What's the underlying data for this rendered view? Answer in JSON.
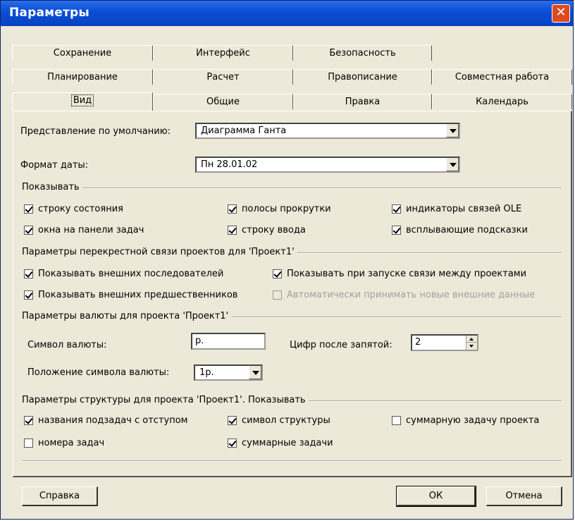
{
  "window": {
    "title": "Параметры",
    "close_glyph": "✕"
  },
  "tabs": {
    "row1": [
      "Сохранение",
      "Интерфейс",
      "Безопасность"
    ],
    "row2": [
      "Планирование",
      "Расчет",
      "Правописание",
      "Совместная работа"
    ],
    "row3": [
      "Вид",
      "Общие",
      "Правка",
      "Календарь"
    ],
    "active": "Вид"
  },
  "view": {
    "default_view_label": "Представление по умолчанию:",
    "default_view_value": "Диаграмма Ганта",
    "date_format_label": "Формат даты:",
    "date_format_value": "Пн 28.01.02"
  },
  "show": {
    "title": "Показывать",
    "items": [
      {
        "label": "строку состояния",
        "checked": true
      },
      {
        "label": "полосы прокрутки",
        "checked": true
      },
      {
        "label": "индикаторы связей OLE",
        "checked": true
      },
      {
        "label": "окна на панели задач",
        "checked": true
      },
      {
        "label": "строку ввода",
        "checked": true
      },
      {
        "label": "всплывающие подсказки",
        "checked": true
      }
    ]
  },
  "crosslink": {
    "title": "Параметры перекрестной связи проектов для 'Проект1'",
    "items": [
      {
        "label": "Показывать внешних последователей",
        "checked": true
      },
      {
        "label": "Показывать при запуске связи между проектами",
        "checked": true
      },
      {
        "label": "Показывать внешних предшественников",
        "checked": true
      },
      {
        "label": "Автоматически принимать новые внешние данные",
        "checked": false,
        "disabled": true
      }
    ]
  },
  "currency": {
    "title": "Параметры валюты для проекта 'Проект1'",
    "symbol_label": "Символ валюты:",
    "symbol_value": "р.",
    "digits_label": "Цифр после запятой:",
    "digits_value": "2",
    "position_label": "Положение символа валюты:",
    "position_value": "1р."
  },
  "outline": {
    "title": "Параметры структуры для проекта 'Проект1'. Показывать",
    "items": [
      {
        "label": "названия подзадач с отступом",
        "checked": true
      },
      {
        "label": "символ структуры",
        "checked": true
      },
      {
        "label": "суммарную задачу проекта",
        "checked": false
      },
      {
        "label": "номера задач",
        "checked": false
      },
      {
        "label": "суммарные задачи",
        "checked": true
      }
    ]
  },
  "buttons": {
    "help": "Справка",
    "ok": "ОК",
    "cancel": "Отмена"
  }
}
